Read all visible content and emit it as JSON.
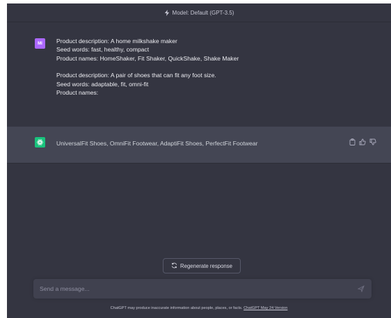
{
  "header": {
    "model_label": "Model: Default (GPT-3.5)",
    "bolt_icon": "lightning-bolt-icon"
  },
  "conversation": {
    "user": {
      "avatar_initials": "MI",
      "avatar_color": "#ab68ff",
      "lines": [
        "Product description: A home milkshake maker",
        "Seed words: fast, healthy, compact",
        "Product names: HomeShaker, Fit Shaker, QuickShake, Shake Maker",
        "",
        "Product description: A pair of shoes that can fit any foot size.",
        "Seed words:  adaptable, fit, omni-fit",
        "Product names:"
      ]
    },
    "assistant": {
      "avatar_icon": "openai-logo-icon",
      "avatar_color": "#19c37d",
      "text": "UniversalFit Shoes, OmniFit Footwear, AdaptiFit Shoes, PerfectFit Footwear",
      "actions": [
        "copy-icon",
        "thumbs-up-icon",
        "thumbs-down-icon"
      ]
    }
  },
  "regenerate": {
    "label": "Regenerate response",
    "icon": "refresh-icon"
  },
  "composer": {
    "placeholder": "Send a message...",
    "send_icon": "send-icon"
  },
  "footer": {
    "text": "ChatGPT may produce inaccurate information about people, places, or facts.",
    "link_text": "ChatGPT May 24 Version"
  },
  "colors": {
    "background": "#343541",
    "assistant_row": "#444654",
    "input": "#40414f"
  }
}
